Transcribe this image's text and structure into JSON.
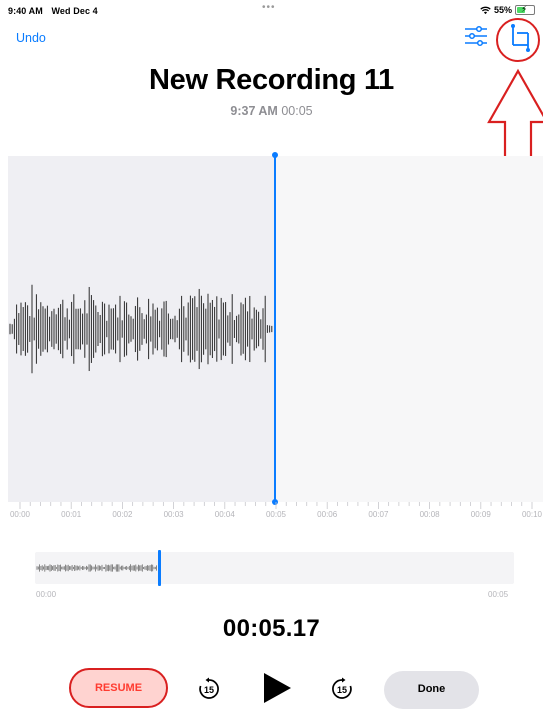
{
  "status_bar": {
    "time": "9:40 AM",
    "date": "Wed Dec 4",
    "dots": "•••",
    "battery_percent": "55%",
    "battery_level": 0.55,
    "wifi_icon": "wifi-icon",
    "charging_icon": "bolt-icon"
  },
  "header": {
    "undo_label": "Undo",
    "filter_icon": "sliders-icon",
    "crop_icon": "trim-crop-icon"
  },
  "recording": {
    "title": "New Recording 11",
    "time": "9:37 AM",
    "duration": "00:05"
  },
  "timeline": {
    "labels": [
      "00:00",
      "00:01",
      "00:02",
      "00:03",
      "00:04",
      "00:05",
      "00:06",
      "00:07",
      "00:08",
      "00:09",
      "00:10"
    ]
  },
  "overview": {
    "start_label": "00:00",
    "end_label": "00:05"
  },
  "playback": {
    "elapsed": "00:05.17",
    "resume_label": "RESUME",
    "skip_back_label": "15",
    "skip_forward_label": "15",
    "done_label": "Done"
  },
  "colors": {
    "accent": "#0a7cff",
    "record_red": "#ff3b30",
    "annotation_red": "#d92020"
  }
}
